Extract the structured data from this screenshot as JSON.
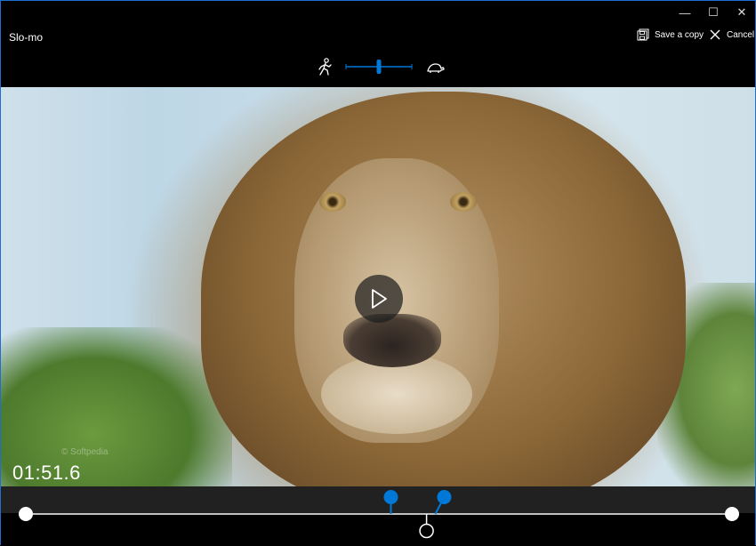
{
  "window": {
    "title": "Slo-mo",
    "controls": {
      "minimize": "—",
      "maximize": "☐",
      "close": "✕"
    }
  },
  "toolbar": {
    "save_label": "Save a copy",
    "save_icon": "save-copy-icon",
    "cancel_label": "Cancel",
    "cancel_icon": "close-icon"
  },
  "speed": {
    "left_icon": "walking-person-icon",
    "right_icon": "turtle-icon",
    "level": 0.5,
    "accent": "#0078d7"
  },
  "video": {
    "play_icon": "play-icon",
    "watermark": "© Softpedia",
    "timecode": "01:51.6"
  },
  "timeline": {
    "accent": "#0078d7",
    "start_pos": 0,
    "end_pos": 1,
    "slomo_start": 0.517,
    "slomo_end": 0.5925,
    "playhead": 0.5675
  }
}
